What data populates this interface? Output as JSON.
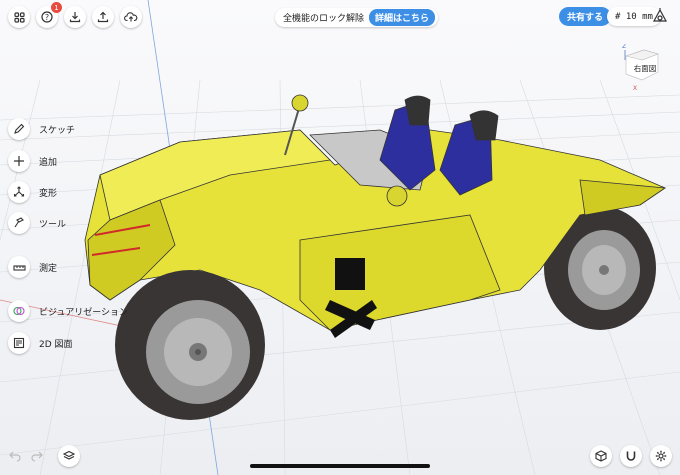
{
  "header": {
    "unlock_text": "全機能のロック解除",
    "details_label": "詳細はこちら",
    "share_label": "共有する",
    "grid_size": "# 10 mm",
    "help_badge": "1"
  },
  "viewcube": {
    "face_label": "右面図",
    "axis_z": "Z",
    "axis_x": "X"
  },
  "tools": [
    {
      "label": "スケッチ",
      "icon": "pen-icon"
    },
    {
      "label": "追加",
      "icon": "plus-icon"
    },
    {
      "label": "変形",
      "icon": "transform-icon"
    },
    {
      "label": "ツール",
      "icon": "hammer-icon"
    },
    {
      "label": "測定",
      "icon": "ruler-icon"
    },
    {
      "label": "ビジュアリゼーション",
      "icon": "visualization-icon"
    },
    {
      "label": "2D 図面",
      "icon": "drawing-icon"
    }
  ],
  "colors": {
    "accent": "#3d8fe6",
    "car_body": "#e6e23a",
    "seat": "#2e2f9e",
    "badge": "#e74c3c"
  }
}
